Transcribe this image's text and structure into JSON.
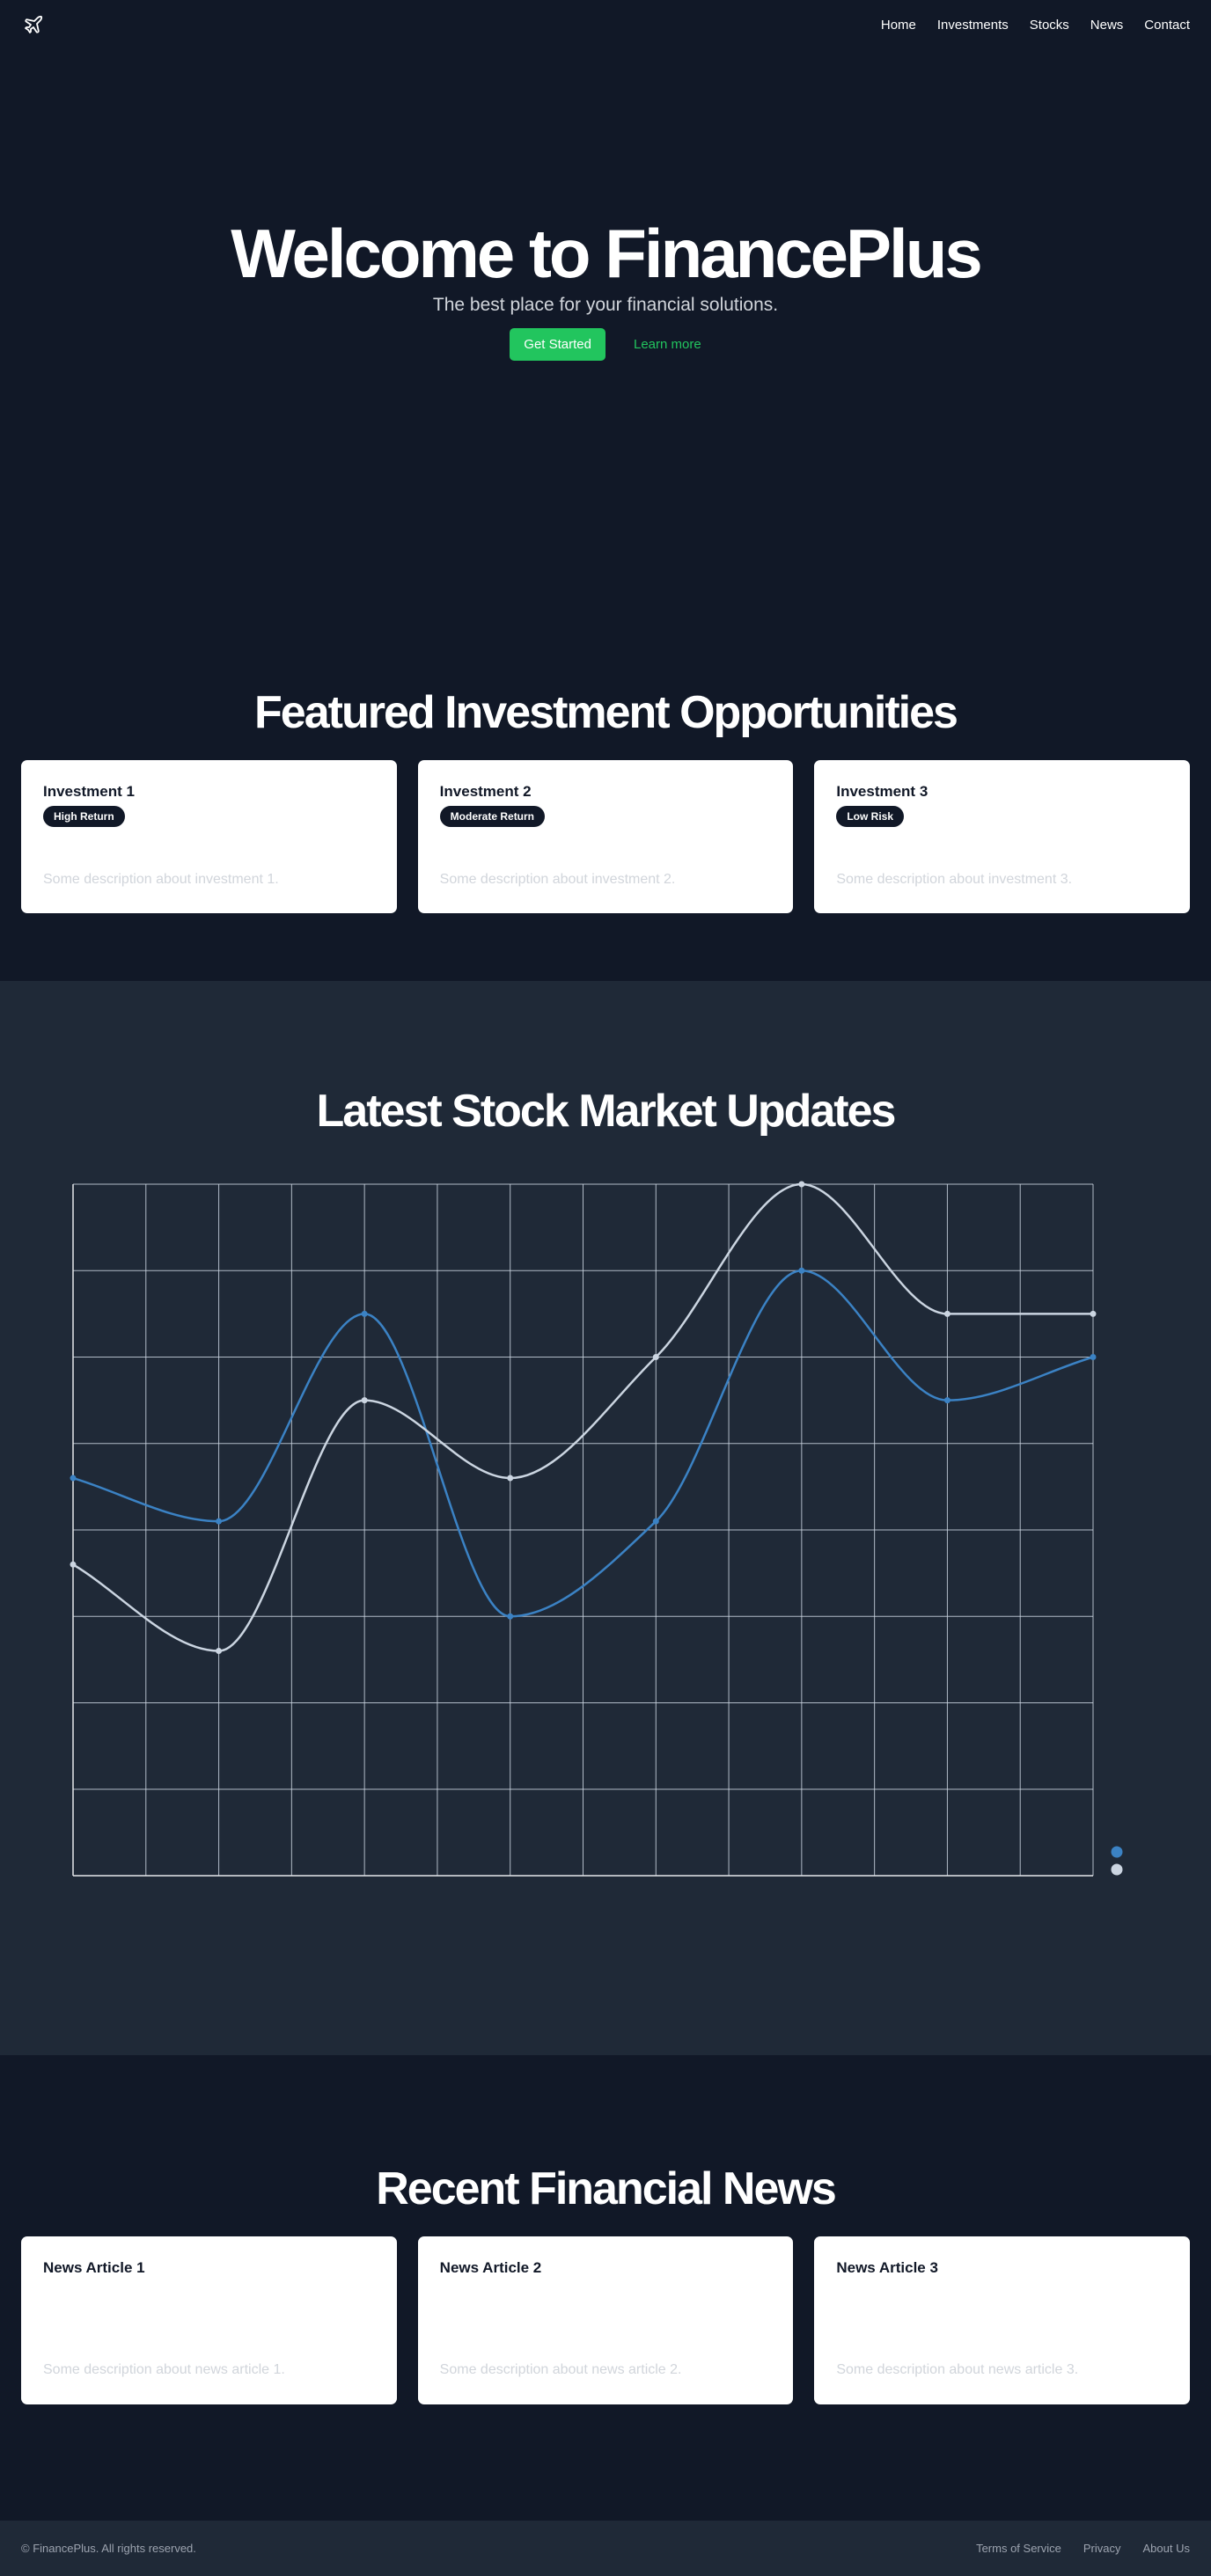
{
  "nav": {
    "logo_icon": "plane-icon",
    "links": [
      "Home",
      "Investments",
      "Stocks",
      "News",
      "Contact"
    ]
  },
  "hero": {
    "title": "Welcome to FinancePlus",
    "subtitle": "The best place for your financial solutions.",
    "cta_label": "Get Started",
    "secondary_label": "Learn more"
  },
  "featured": {
    "title": "Featured Investment Opportunities",
    "cards": [
      {
        "title": "Investment 1",
        "badge": "High Return",
        "description": "Some description about investment 1."
      },
      {
        "title": "Investment 2",
        "badge": "Moderate Return",
        "description": "Some description about investment 2."
      },
      {
        "title": "Investment 3",
        "badge": "Low Risk",
        "description": "Some description about investment 3."
      }
    ]
  },
  "stocks": {
    "title": "Latest Stock Market Updates"
  },
  "chart_data": {
    "type": "line",
    "x": [
      0,
      1,
      2,
      3,
      4,
      5,
      6,
      7
    ],
    "ylim": [
      0,
      8
    ],
    "grid": true,
    "legend_position": "bottom-right",
    "series": [
      {
        "color": "#3b82c4",
        "values": [
          4.6,
          4.1,
          6.5,
          3.0,
          4.1,
          7.0,
          5.5,
          6.0
        ]
      },
      {
        "color": "#cbd5e1",
        "values": [
          3.6,
          2.6,
          5.5,
          4.6,
          6.0,
          8.0,
          6.5,
          6.5
        ]
      }
    ],
    "colors": {
      "grid": "#cbd5e1",
      "axis": "#e5e7eb"
    }
  },
  "news": {
    "title": "Recent Financial News",
    "cards": [
      {
        "title": "News Article 1",
        "description": "Some description about news article 1."
      },
      {
        "title": "News Article 2",
        "description": "Some description about news article 2."
      },
      {
        "title": "News Article 3",
        "description": "Some description about news article 3."
      }
    ]
  },
  "footer": {
    "copyright": "© FinancePlus. All rights reserved.",
    "links": [
      "Terms of Service",
      "Privacy",
      "About Us"
    ]
  },
  "colors": {
    "background": "#111827",
    "section_alt": "#1f2937",
    "accent": "#22c55e",
    "card": "#ffffff"
  }
}
